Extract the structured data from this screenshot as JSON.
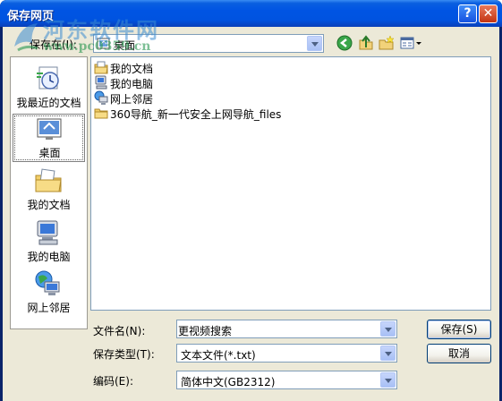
{
  "window": {
    "title": "保存网页",
    "help_label": "?",
    "close_label": "✕"
  },
  "watermark": {
    "line1": "河东软件网",
    "line2": "www.pc0359.cn"
  },
  "location": {
    "label": "保存在(I):",
    "value": "桌面"
  },
  "toolbar": {
    "icons": [
      "back-icon",
      "up-folder-icon",
      "new-folder-icon",
      "view-menu-icon"
    ]
  },
  "places": [
    {
      "label": "我最近的文档",
      "icon": "recent-documents-icon"
    },
    {
      "label": "桌面",
      "icon": "desktop-icon",
      "selected": true
    },
    {
      "label": "我的文档",
      "icon": "my-documents-icon"
    },
    {
      "label": "我的电脑",
      "icon": "my-computer-icon"
    },
    {
      "label": "网上邻居",
      "icon": "network-places-icon"
    }
  ],
  "files": [
    {
      "name": "我的文档",
      "icon": "my-documents-icon"
    },
    {
      "name": "我的电脑",
      "icon": "my-computer-icon"
    },
    {
      "name": "网上邻居",
      "icon": "network-places-icon"
    },
    {
      "name": "360导航_新一代安全上网导航_files",
      "icon": "folder-icon"
    }
  ],
  "filename": {
    "label": "文件名(N):",
    "value": "更视频搜索"
  },
  "filetype": {
    "label": "保存类型(T):",
    "value": "文本文件(*.txt)"
  },
  "encoding": {
    "label": "编码(E):",
    "value": "简体中文(GB2312)"
  },
  "buttons": {
    "save": "保存(S)",
    "cancel": "取消"
  }
}
